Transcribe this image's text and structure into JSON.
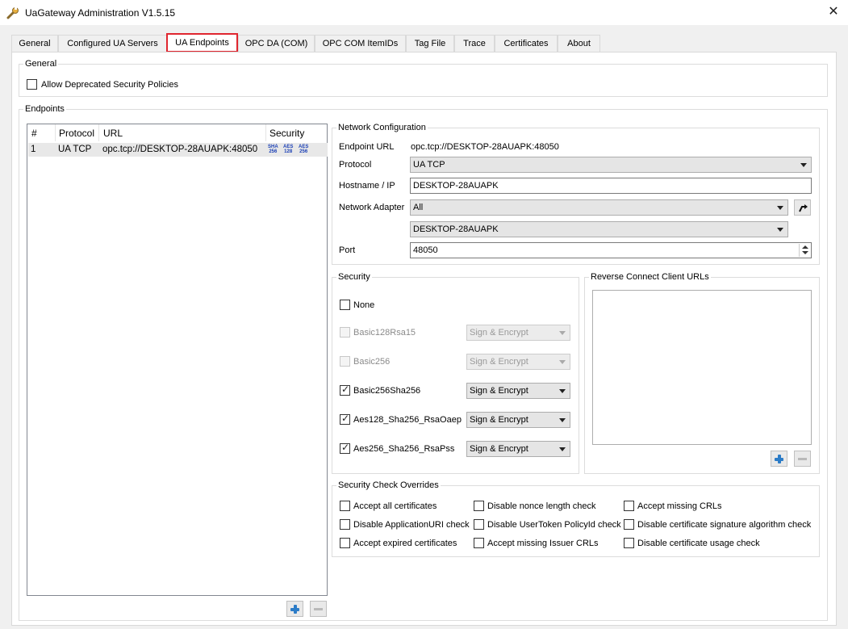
{
  "window": {
    "title": "UaGateway Administration V1.5.15"
  },
  "tabs": [
    {
      "label": "General"
    },
    {
      "label": "Configured UA Servers"
    },
    {
      "label": "UA Endpoints"
    },
    {
      "label": "OPC DA (COM)"
    },
    {
      "label": "OPC COM ItemIDs"
    },
    {
      "label": "Tag File"
    },
    {
      "label": "Trace"
    },
    {
      "label": "Certificates"
    },
    {
      "label": "About"
    }
  ],
  "general_group": {
    "label": "General",
    "allow_deprecated": {
      "label": "Allow Deprecated Security Policies",
      "checked": false
    }
  },
  "endpoints_group": {
    "label": "Endpoints",
    "columns": [
      "#",
      "Protocol",
      "URL",
      "Security"
    ],
    "rows": [
      {
        "index": "1",
        "protocol": "UA TCP",
        "url": "opc.tcp://DESKTOP-28AUAPK:48050",
        "security_badges": [
          [
            "SHA",
            "256"
          ],
          [
            "AES",
            "128"
          ],
          [
            "AES",
            "256"
          ]
        ]
      }
    ]
  },
  "network": {
    "label": "Network Configuration",
    "endpoint_url_label": "Endpoint URL",
    "endpoint_url_value": "opc.tcp://DESKTOP-28AUAPK:48050",
    "protocol_label": "Protocol",
    "protocol_value": "UA TCP",
    "hostname_label": "Hostname / IP",
    "hostname_value": "DESKTOP-28AUAPK",
    "adapter_label": "Network Adapter",
    "adapter_value": "All",
    "adapter_host_value": "DESKTOP-28AUAPK",
    "port_label": "Port",
    "port_value": "48050"
  },
  "security": {
    "label": "Security",
    "policies": [
      {
        "name": "None",
        "checked": false,
        "enabled": true,
        "mode": null
      },
      {
        "name": "Basic128Rsa15",
        "checked": false,
        "enabled": false,
        "mode": "Sign & Encrypt"
      },
      {
        "name": "Basic256",
        "checked": false,
        "enabled": false,
        "mode": "Sign & Encrypt"
      },
      {
        "name": "Basic256Sha256",
        "checked": true,
        "enabled": true,
        "mode": "Sign & Encrypt"
      },
      {
        "name": "Aes128_Sha256_RsaOaep",
        "checked": true,
        "enabled": true,
        "mode": "Sign & Encrypt"
      },
      {
        "name": "Aes256_Sha256_RsaPss",
        "checked": true,
        "enabled": true,
        "mode": "Sign & Encrypt"
      }
    ]
  },
  "reverse_connect": {
    "label": "Reverse Connect Client URLs"
  },
  "overrides": {
    "label": "Security Check Overrides",
    "items": [
      "Accept all certificates",
      "Disable nonce length check",
      "Accept missing CRLs",
      "Disable ApplicationURI check",
      "Disable UserToken PolicyId check",
      "Disable certificate signature algorithm check",
      "Accept expired certificates",
      "Accept missing Issuer CRLs",
      "Disable certificate usage check"
    ]
  },
  "icons": {
    "app": "wrench-icon",
    "close": "close-icon",
    "add": "plus-icon",
    "remove": "minus-icon",
    "apply": "arrow-return-icon"
  },
  "colors": {
    "active_tab_border": "#e0262f",
    "plus_icon": "#2c7cc7",
    "security_badge": "#1a3fb5"
  }
}
